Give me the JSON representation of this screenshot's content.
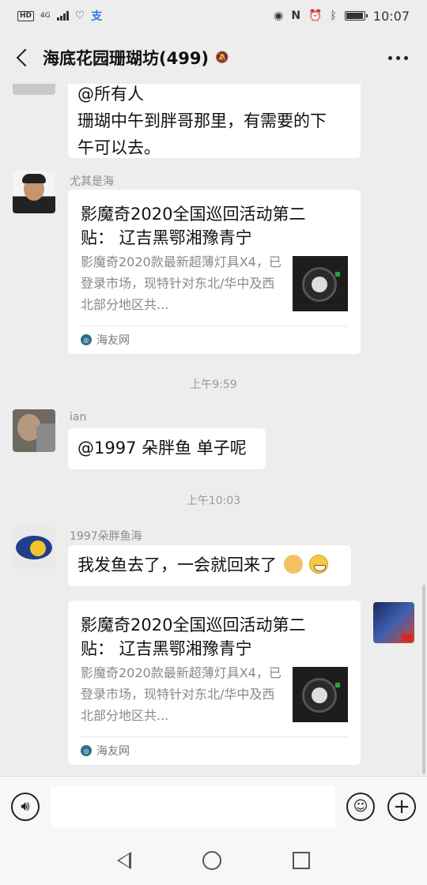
{
  "status_bar": {
    "network_hd": "HD",
    "network_type": "4G",
    "time": "10:07",
    "icons": [
      "signal-icon",
      "heart-icon",
      "alipay-icon",
      "eye-icon",
      "nfc-icon",
      "alarm-icon",
      "bluetooth-icon",
      "battery-icon"
    ]
  },
  "header": {
    "title": "海底花园珊瑚坊(499)",
    "muted_icon": "bell-off-icon"
  },
  "messages": {
    "m0": {
      "text_line1": "@所有人",
      "text_line2": "珊瑚中午到胖哥那里，有需要的下",
      "text_line3": "午可以去。"
    },
    "m1": {
      "sender": "尤其是海",
      "card_title": "影魔奇2020全国巡回活动第二贴： 辽吉黑鄂湘豫青宁",
      "card_desc": "影魔奇2020款最新超薄灯具X4，已登录市场，现特针对东北/华中及西北部分地区共...",
      "card_source": "海友网"
    },
    "t1": "上午9:59",
    "m2": {
      "sender": "ian",
      "text": "@1997 朵胖鱼  单子呢"
    },
    "t2": "上午10:03",
    "m3": {
      "sender": "1997朵胖鱼海",
      "text": "我发鱼去了，一会就回来了"
    },
    "m4": {
      "card_title": "影魔奇2020全国巡回活动第二贴： 辽吉黑鄂湘豫青宁",
      "card_desc": "影魔奇2020款最新超薄灯具X4，已登录市场，现特针对东北/华中及西北部分地区共...",
      "card_source": "海友网"
    }
  },
  "input": {
    "placeholder": ""
  },
  "colors": {
    "background": "#ededed",
    "bubble": "#ffffff",
    "accent": "#2a6f8a"
  }
}
